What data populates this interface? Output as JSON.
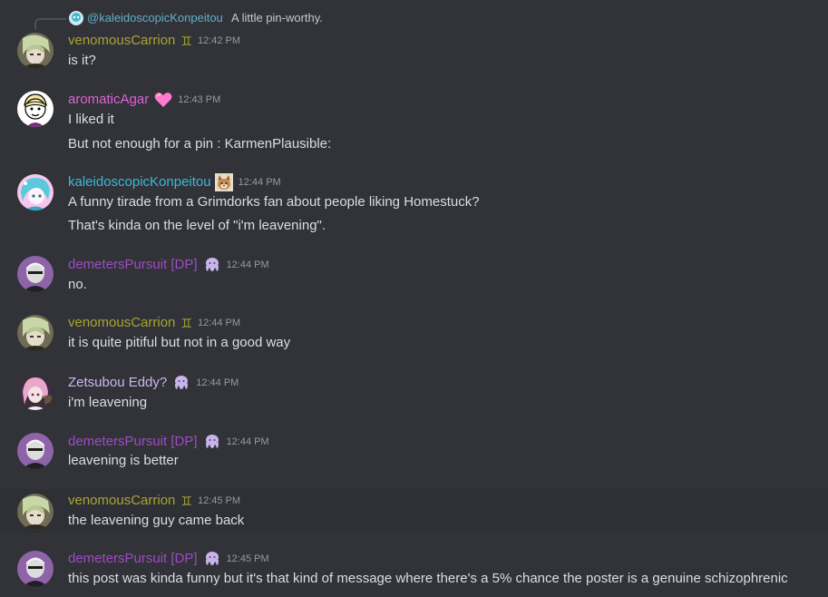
{
  "reply": {
    "mention": "@kaleidoscopicKonpeitou",
    "text": "A little pin-worthy."
  },
  "colors": {
    "venomousCarrion": "#a8a530",
    "aromaticAgar": "#e060d8",
    "kaleidoscopicKonpeitou": "#3bb9d8",
    "demetersPursuit": "#9d4cc4",
    "zetsubouEddy": "#cdb6f0",
    "timestamp": "#949ba4",
    "background": "#313338"
  },
  "messages": [
    {
      "username": "venomousCarrion",
      "badge": "gemini-icon",
      "timestamp": "12:42 PM",
      "lines": [
        "is it?"
      ]
    },
    {
      "username": "aromaticAgar",
      "badge": "pink-heart-icon",
      "timestamp": "12:43 PM",
      "lines": [
        "I liked it",
        "But not enough for a pin : KarmenPlausible:"
      ]
    },
    {
      "username": "kaleidoscopicKonpeitou",
      "badge": "dog-icon",
      "timestamp": "12:44 PM",
      "lines": [
        "A funny tirade from a Grimdorks fan about people liking Homestuck?",
        "That's kinda on the level of \"i'm leavening\"."
      ]
    },
    {
      "username": "demetersPursuit [DP]",
      "badge": "octopus-icon",
      "timestamp": "12:44 PM",
      "lines": [
        "no."
      ]
    },
    {
      "username": "venomousCarrion",
      "badge": "gemini-icon",
      "timestamp": "12:44 PM",
      "lines": [
        "it is quite pitiful but not in a good way"
      ]
    },
    {
      "username": "Zetsubou Eddy?",
      "badge": "octopus-icon",
      "timestamp": "12:44 PM",
      "lines": [
        "i'm leavening"
      ]
    },
    {
      "username": "demetersPursuit [DP]",
      "badge": "octopus-icon",
      "timestamp": "12:44 PM",
      "lines": [
        "leavening is better"
      ]
    },
    {
      "username": "venomousCarrion",
      "badge": "gemini-icon",
      "timestamp": "12:45 PM",
      "lines": [
        "the leavening guy came back"
      ]
    },
    {
      "username": "demetersPursuit [DP]",
      "badge": "octopus-icon",
      "timestamp": "12:45 PM",
      "lines": [
        "this post was kinda funny but it's that kind of message where there's a 5% chance the poster is a genuine schizophrenic"
      ]
    }
  ]
}
